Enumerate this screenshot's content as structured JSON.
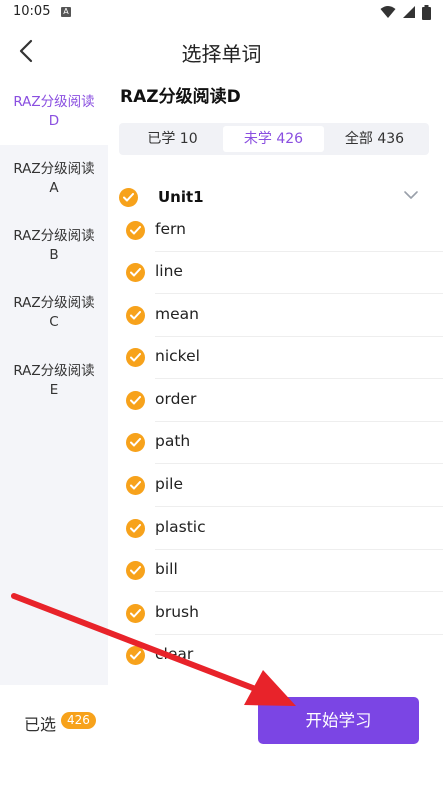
{
  "status_bar": {
    "time": "10:05",
    "notification_badge": "A"
  },
  "header": {
    "title": "选择单词"
  },
  "sidebar": {
    "items": [
      {
        "label": "RAZ分级阅读D",
        "active": true
      },
      {
        "label": "RAZ分级阅读A",
        "active": false
      },
      {
        "label": "RAZ分级阅读B",
        "active": false
      },
      {
        "label": "RAZ分级阅读C",
        "active": false
      },
      {
        "label": "RAZ分级阅读E",
        "active": false
      }
    ]
  },
  "main": {
    "book_title": "RAZ分级阅读D",
    "tabs": [
      {
        "label": "已学 10",
        "active": false
      },
      {
        "label": "未学 426",
        "active": true
      },
      {
        "label": "全部 436",
        "active": false
      }
    ],
    "unit": {
      "name": "Unit1",
      "checked": true
    },
    "words": [
      "fern",
      "line",
      "mean",
      "nickel",
      "order",
      "path",
      "pile",
      "plastic",
      "bill",
      "brush",
      "clear"
    ]
  },
  "bottom": {
    "selected_label": "已选",
    "selected_count": "426",
    "start_label": "开始学习"
  },
  "colors": {
    "accent": "#7b45e4",
    "check": "#f7a21b",
    "arrow": "#e8232a"
  }
}
